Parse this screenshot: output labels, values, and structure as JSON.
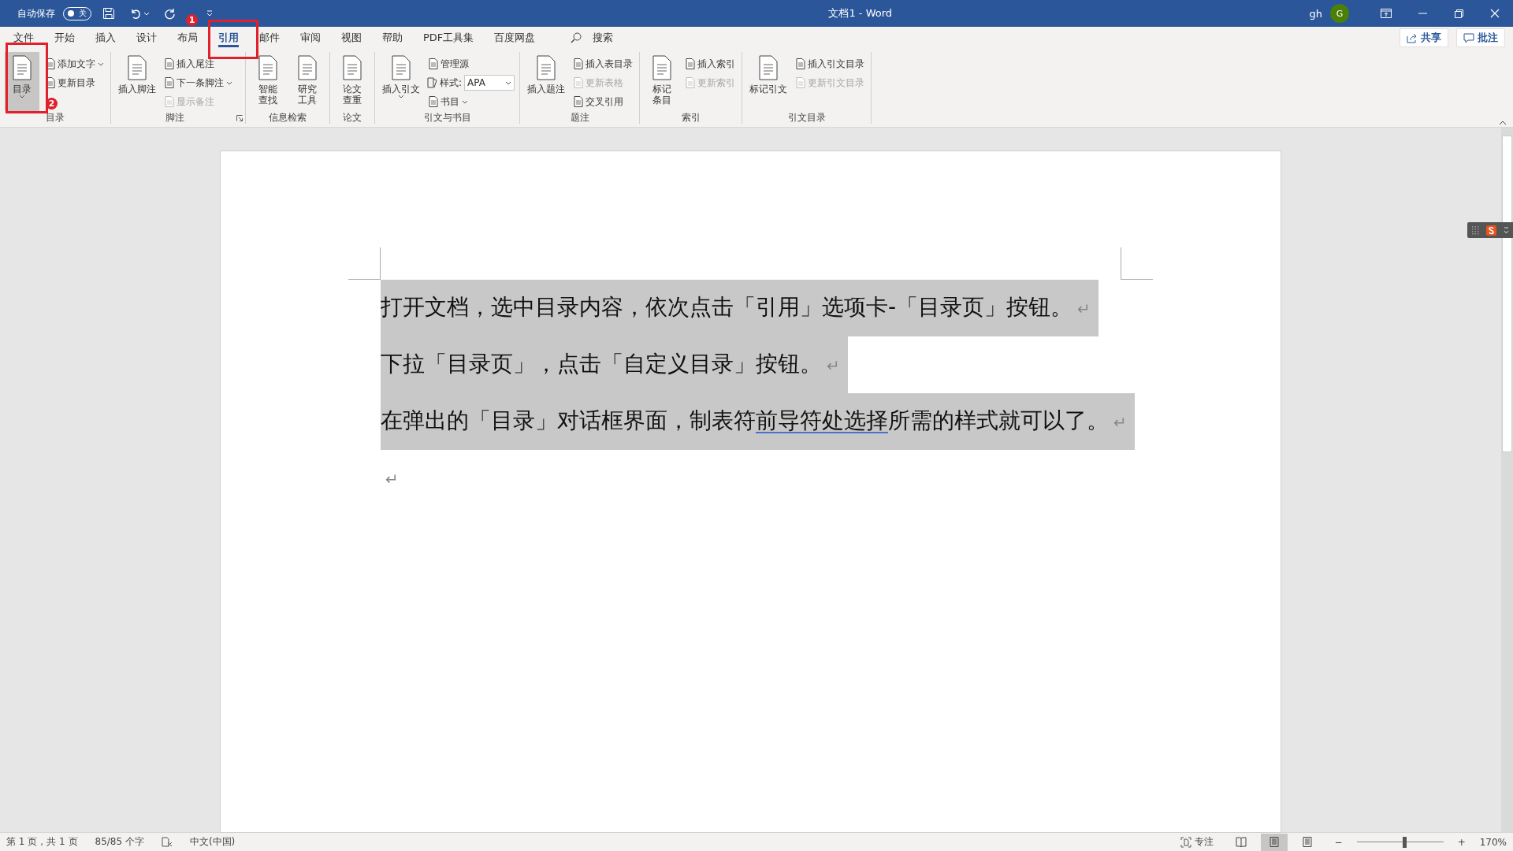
{
  "title_bar": {
    "autosave_label": "自动保存",
    "autosave_toggle": {
      "label": "关",
      "on": false
    },
    "title": "文档1  -  Word",
    "user": "gh",
    "avatar": "G"
  },
  "tabs": [
    {
      "label": "文件",
      "selected": false
    },
    {
      "label": "开始",
      "selected": false
    },
    {
      "label": "插入",
      "selected": false
    },
    {
      "label": "设计",
      "selected": false
    },
    {
      "label": "布局",
      "selected": false
    },
    {
      "label": "引用",
      "selected": true
    },
    {
      "label": "邮件",
      "selected": false
    },
    {
      "label": "审阅",
      "selected": false
    },
    {
      "label": "视图",
      "selected": false
    },
    {
      "label": "帮助",
      "selected": false
    },
    {
      "label": "PDF工具集",
      "selected": false
    },
    {
      "label": "百度网盘",
      "selected": false
    }
  ],
  "search": {
    "label": "搜索"
  },
  "share_button": "共享",
  "comments_button": "批注",
  "ribbon_groups": [
    {
      "label": "目录",
      "columns": [
        {
          "kind": "large",
          "label": "目录",
          "dropdown": true,
          "pressed": true
        },
        {
          "kind": "stack",
          "items": [
            {
              "label": "添加文字",
              "dropdown": true,
              "disabled": false
            },
            {
              "label": "更新目录",
              "disabled": false
            }
          ]
        }
      ]
    },
    {
      "label": "脚注",
      "launcher": true,
      "columns": [
        {
          "kind": "large",
          "label": "插入脚注",
          "pressed": false
        },
        {
          "kind": "stack",
          "items": [
            {
              "label": "插入尾注",
              "disabled": false
            },
            {
              "label": "下一条脚注",
              "dropdown": true,
              "disabled": false
            },
            {
              "label": "显示备注",
              "disabled": true
            }
          ]
        }
      ]
    },
    {
      "label": "信息检索",
      "columns": [
        {
          "kind": "large_two_line",
          "label": "智能查找",
          "pressed": false
        },
        {
          "kind": "large_two_line",
          "label": "研究工具",
          "pressed": false
        }
      ]
    },
    {
      "label": "论文",
      "columns": [
        {
          "kind": "large_two_line",
          "label": "论文查重",
          "pressed": false
        }
      ]
    },
    {
      "label": "引文与书目",
      "columns": [
        {
          "kind": "large",
          "label": "插入引文",
          "dropdown": true,
          "pressed": false
        },
        {
          "kind": "stack",
          "items": [
            {
              "label": "管理源",
              "disabled": false
            },
            {
              "kind": "select",
              "label": "样式:",
              "value": "APA"
            },
            {
              "label": "书目",
              "dropdown": true,
              "disabled": false
            }
          ]
        }
      ]
    },
    {
      "label": "题注",
      "columns": [
        {
          "kind": "large",
          "label": "插入题注",
          "pressed": false
        },
        {
          "kind": "stack",
          "items": [
            {
              "label": "插入表目录",
              "disabled": false
            },
            {
              "label": "更新表格",
              "disabled": true
            },
            {
              "label": "交叉引用",
              "disabled": false
            }
          ]
        }
      ]
    },
    {
      "label": "索引",
      "columns": [
        {
          "kind": "large_two_line",
          "label": "标记条目",
          "pressed": false
        },
        {
          "kind": "stack",
          "items": [
            {
              "label": "插入索引",
              "disabled": false
            },
            {
              "label": "更新索引",
              "disabled": true
            }
          ]
        }
      ]
    },
    {
      "label": "引文目录",
      "columns": [
        {
          "kind": "large",
          "label": "标记引文",
          "pressed": false
        },
        {
          "kind": "stack",
          "items": [
            {
              "label": "插入引文目录",
              "disabled": false
            },
            {
              "label": "更新引文目录",
              "disabled": true
            }
          ]
        }
      ]
    }
  ],
  "paragraphs": [
    {
      "highlighted": true,
      "mark": "↵",
      "segments": [
        {
          "text": "打开文档，选中目录内容，依次点击「引用」选项卡-「目录页」按钮。"
        }
      ]
    },
    {
      "highlighted": true,
      "mark": "↵",
      "segments": [
        {
          "text": "下拉「目录页」，点击「自定义目录」按钮。"
        }
      ]
    },
    {
      "highlighted": true,
      "mark": "↵",
      "segments": [
        {
          "text": "在弹出的「目录」对话框界面，制表符"
        },
        {
          "text": "前导符处选择",
          "flagged": true
        },
        {
          "text": "所需的样式就可以了。"
        }
      ]
    },
    {
      "highlighted": false,
      "mark": "↵"
    }
  ],
  "annotations": [
    {
      "label": "1"
    },
    {
      "label": "2"
    }
  ],
  "status_bar": {
    "page": "第 1 页，共 1 页",
    "words": "85/85 个字",
    "language": "中文(中国)",
    "focus": "专注",
    "views": [
      {
        "selected": false
      },
      {
        "selected": true
      },
      {
        "selected": false
      }
    ],
    "zoom_out": "−",
    "zoom_in": "+",
    "zoom": {
      "level": 0.55
    },
    "zoom_reading": "170%"
  }
}
